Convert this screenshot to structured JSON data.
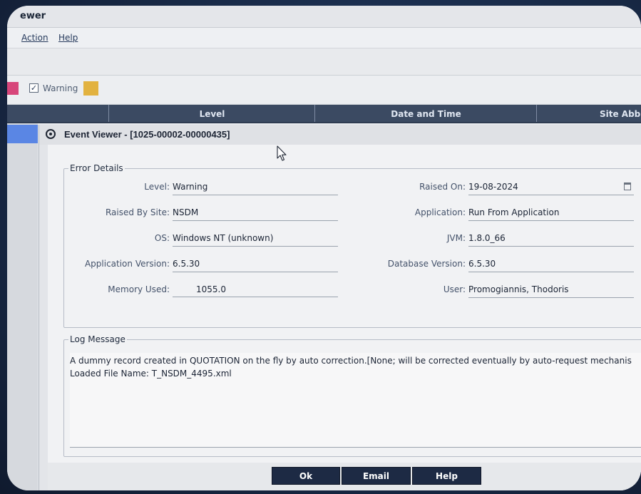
{
  "app": {
    "title": "ewer",
    "menu": [
      "Action",
      "Help"
    ]
  },
  "filter": {
    "warning_label": "Warning",
    "warning_checked": true,
    "colors": {
      "error": "#d7467a",
      "warning": "#e2b240"
    }
  },
  "table": {
    "columns": [
      "Level",
      "Date and Time",
      "Site Abb"
    ]
  },
  "dialog": {
    "title": "Event Viewer - [1025-00002-00000435]",
    "error_details": {
      "legend": "Error Details",
      "fields": {
        "level": {
          "label": "Level:",
          "value": "Warning"
        },
        "raised_on": {
          "label": "Raised On:",
          "value": "19-08-2024"
        },
        "raised_by_site": {
          "label": "Raised By Site:",
          "value": "NSDM"
        },
        "application": {
          "label": "Application:",
          "value": "Run From Application"
        },
        "os": {
          "label": "OS:",
          "value": "Windows NT (unknown)"
        },
        "jvm": {
          "label": "JVM:",
          "value": "1.8.0_66"
        },
        "application_version": {
          "label": "Application Version:",
          "value": "6.5.30"
        },
        "database_version": {
          "label": "Database Version:",
          "value": "6.5.30"
        },
        "memory_used": {
          "label": "Memory Used:",
          "value": "1055.0"
        },
        "user": {
          "label": "User:",
          "value": "Promogiannis, Thodoris"
        }
      }
    },
    "log_message": {
      "legend": "Log Message",
      "lines": [
        "A dummy record created in QUOTATION on the fly by auto correction.[None; will be corrected eventually by auto-request mechanis",
        "Loaded File Name: T_NSDM_4495.xml"
      ]
    },
    "buttons": {
      "ok": "Ok",
      "email": "Email",
      "help": "Help"
    }
  },
  "icons": {
    "dialog_icon": "radio-target-icon",
    "calendar": "calendar-icon",
    "cursor": "mouse-pointer-icon"
  }
}
